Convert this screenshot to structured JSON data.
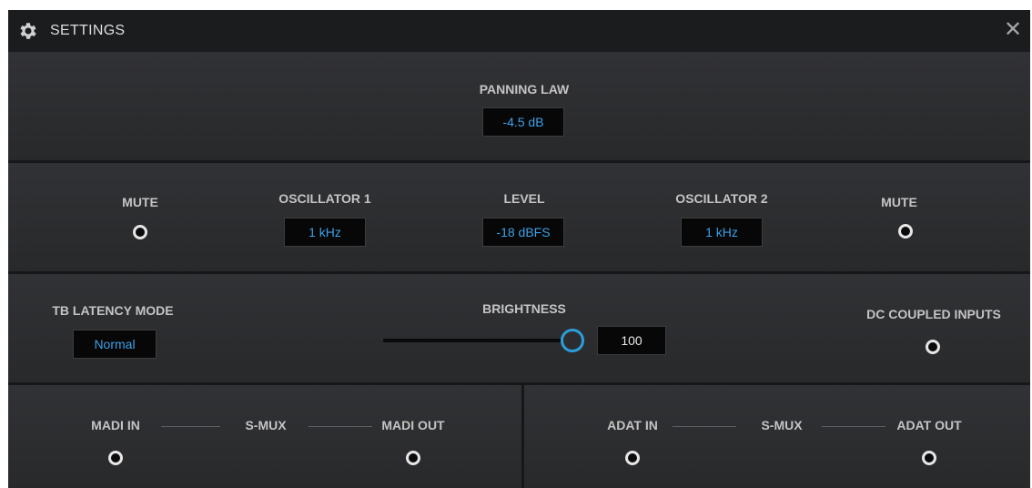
{
  "window": {
    "title": "SETTINGS",
    "close_glyph": "✕",
    "icon": "gear-icon"
  },
  "panning": {
    "label": "PANNING LAW",
    "value": "-4.5 dB"
  },
  "oscillator_row": {
    "mute_left_label": "MUTE",
    "osc1_label": "OSCILLATOR 1",
    "osc1_value": "1 kHz",
    "level_label": "LEVEL",
    "level_value": "-18 dBFS",
    "osc2_label": "OSCILLATOR 2",
    "osc2_value": "1 kHz",
    "mute_right_label": "MUTE"
  },
  "system_row": {
    "tb_latency_label": "TB LATENCY MODE",
    "tb_latency_value": "Normal",
    "brightness_label": "BRIGHTNESS",
    "brightness_value": "100",
    "brightness_level_percent": 100,
    "dc_coupled_label": "DC COUPLED INPUTS"
  },
  "madi": {
    "in_label": "MADI IN",
    "smux_label": "S-MUX",
    "out_label": "MADI OUT"
  },
  "adat": {
    "in_label": "ADAT IN",
    "smux_label": "S-MUX",
    "out_label": "ADAT OUT"
  },
  "colors": {
    "accent": "#3ea0e6",
    "slider_ring": "#2d9cdb",
    "background": "#2b2c2e",
    "titlebar": "#1b1c1e"
  }
}
